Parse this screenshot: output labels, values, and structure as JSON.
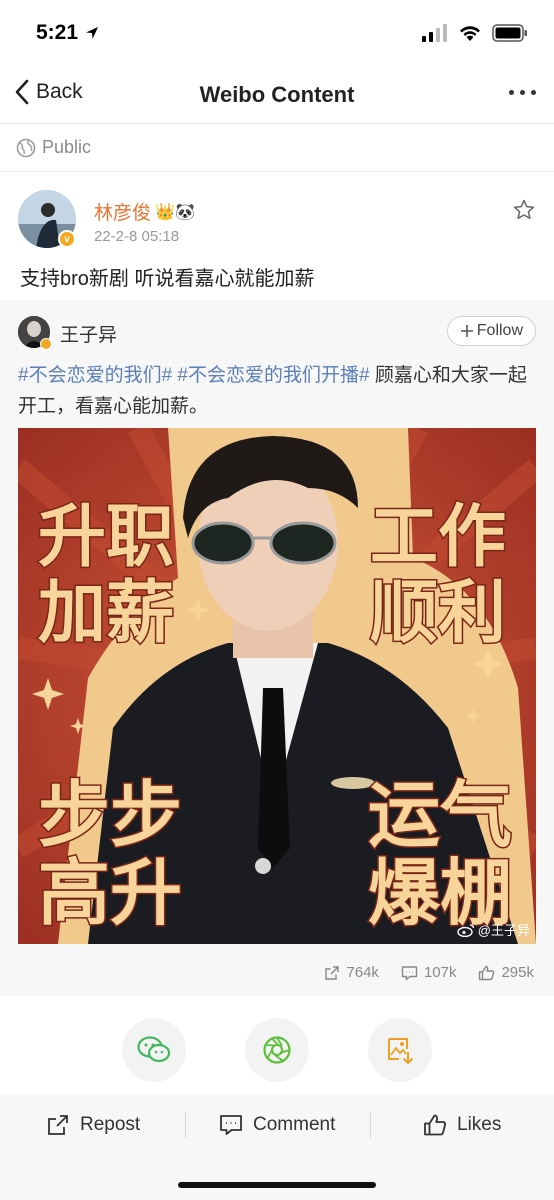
{
  "status_bar": {
    "time": "5:21"
  },
  "nav": {
    "back_label": "Back",
    "title": "Weibo Content"
  },
  "visibility": {
    "label": "Public"
  },
  "post": {
    "author": "林彦俊",
    "author_emoji": "👑🐼",
    "time": "22-2-8 05:18",
    "text": "支持bro新剧 听说看嘉心就能加薪"
  },
  "retweet": {
    "author": "王子异",
    "follow_label": "Follow",
    "hashtag_1": "#不会恋爱的我们#",
    "hashtag_2": "#不会恋爱的我们开播#",
    "text_rest": " 顾嘉心和大家一起开工，看嘉心能加薪。",
    "image": {
      "text_tl_1": "升职",
      "text_tl_2": "加薪",
      "text_tr_1": "工作",
      "text_tr_2": "顺利",
      "text_bl_1": "步步",
      "text_bl_2": "高升",
      "text_br_1": "运气",
      "text_br_2": "爆棚",
      "watermark": "@王子异"
    },
    "stats": {
      "reposts": "764k",
      "comments": "107k",
      "likes": "295k"
    }
  },
  "share": {
    "icons": [
      "wechat-icon",
      "moments-icon",
      "save-image-icon"
    ],
    "colors": {
      "wechat": "#3fb85f",
      "moments": "#5cbf3a",
      "save": "#f0a020"
    }
  },
  "actions": {
    "repost": "Repost",
    "comment": "Comment",
    "likes": "Likes"
  },
  "colors": {
    "author": "#eb7331",
    "hashtag": "#5a7fb8",
    "poster_bg": "#b9412c",
    "poster_text": "#f6d49a"
  }
}
